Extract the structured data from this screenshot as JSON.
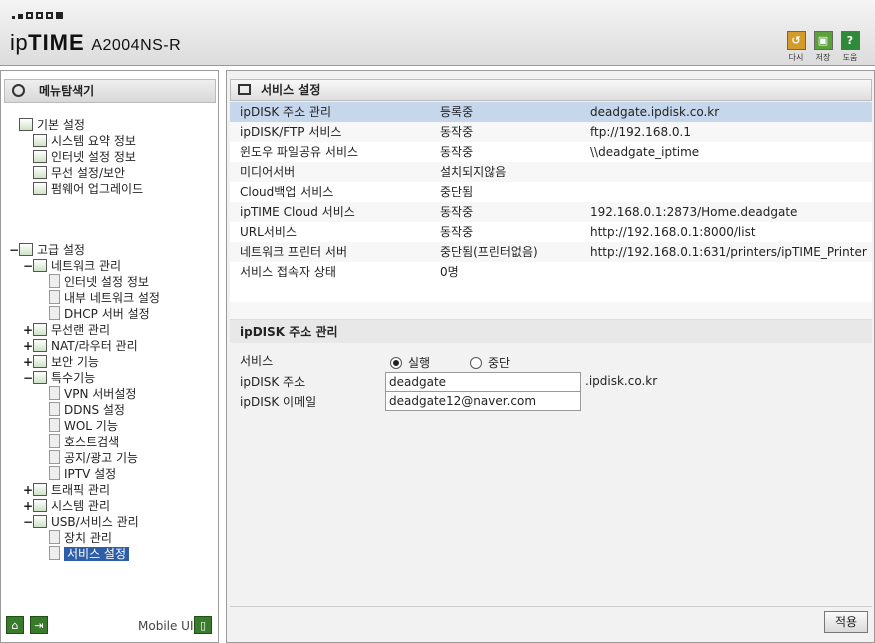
{
  "header": {
    "brand_ip": "ip",
    "brand_time": "TIME",
    "model": "A2004NS-R",
    "buttons": [
      {
        "label": "다시",
        "icon": "refresh-icon",
        "color": "#d39b2a"
      },
      {
        "label": "저장",
        "icon": "save-icon",
        "color": "#5aa13c"
      },
      {
        "label": "도움",
        "icon": "help-icon",
        "color": "#2f8a3a"
      }
    ]
  },
  "left": {
    "title": "메뉴탐색기",
    "tree": [
      {
        "label": "기본 설정",
        "tog": "",
        "level": 0
      },
      {
        "label": "시스템 요약 정보",
        "tog": "",
        "level": 1
      },
      {
        "label": "인터넷 설정 정보",
        "tog": "",
        "level": 1
      },
      {
        "label": "무선 설정/보안",
        "tog": "",
        "level": 1
      },
      {
        "label": "펌웨어 업그레이드",
        "tog": "",
        "level": 1
      },
      {
        "label": "고급 설정",
        "tog": "−",
        "level": 0
      },
      {
        "label": "네트워크 관리",
        "tog": "−",
        "level": 1
      },
      {
        "label": "인터넷 설정 정보",
        "tog": "",
        "level": 2
      },
      {
        "label": "내부 네트워크 설정",
        "tog": "",
        "level": 2
      },
      {
        "label": "DHCP 서버 설정",
        "tog": "",
        "level": 2
      },
      {
        "label": "무선랜 관리",
        "tog": "+",
        "level": 1
      },
      {
        "label": "NAT/라우터 관리",
        "tog": "+",
        "level": 1
      },
      {
        "label": "보안 기능",
        "tog": "+",
        "level": 1
      },
      {
        "label": "특수기능",
        "tog": "−",
        "level": 1
      },
      {
        "label": "VPN 서버설정",
        "tog": "",
        "level": 2
      },
      {
        "label": "DDNS 설정",
        "tog": "",
        "level": 2
      },
      {
        "label": "WOL 기능",
        "tog": "",
        "level": 2
      },
      {
        "label": "호스트검색",
        "tog": "",
        "level": 2
      },
      {
        "label": "공지/광고 기능",
        "tog": "",
        "level": 2
      },
      {
        "label": "IPTV 설정",
        "tog": "",
        "level": 2
      },
      {
        "label": "트래픽 관리",
        "tog": "+",
        "level": 1
      },
      {
        "label": "시스템 관리",
        "tog": "+",
        "level": 1
      },
      {
        "label": "USB/서비스 관리",
        "tog": "−",
        "level": 1
      },
      {
        "label": "장치 관리",
        "tog": "",
        "level": 2
      },
      {
        "label": "서비스 설정",
        "tog": "",
        "level": 2
      }
    ],
    "mobile_label": "Mobile UI"
  },
  "main": {
    "title": "서비스 설정",
    "services": [
      {
        "name": "ipDISK 주소 관리",
        "status": "등록중",
        "info": "deadgate.ipdisk.co.kr"
      },
      {
        "name": "ipDISK/FTP 서비스",
        "status": "동작중",
        "info": "ftp://192.168.0.1"
      },
      {
        "name": "윈도우 파일공유 서비스",
        "status": "동작중",
        "info": "\\\\deadgate_iptime"
      },
      {
        "name": "미디어서버",
        "status": "설치되지않음",
        "info": ""
      },
      {
        "name": "Cloud백업 서비스",
        "status": "중단됨",
        "info": ""
      },
      {
        "name": "ipTIME Cloud 서비스",
        "status": "동작중",
        "info": "192.168.0.1:2873/Home.deadgate"
      },
      {
        "name": "URL서비스",
        "status": "동작중",
        "info": "http://192.168.0.1:8000/list"
      },
      {
        "name": "네트워크 프린터 서버",
        "status": "중단됨(프린터없음)",
        "info": "http://192.168.0.1:631/printers/ipTIME_Printer"
      },
      {
        "name": "서비스 접속자 상태",
        "status": "0명",
        "info": ""
      }
    ],
    "section_title": "ipDISK 주소 관리",
    "form": {
      "service_label": "서비스",
      "run_label": "실행",
      "stop_label": "중단",
      "address_label": "ipDISK 주소",
      "address_value": "deadgate",
      "address_suffix": ".ipdisk.co.kr",
      "email_label": "ipDISK 이메일",
      "email_value": "deadgate12@naver.com"
    },
    "apply_label": "적용",
    "highlight_color": "#c6d7ec"
  }
}
